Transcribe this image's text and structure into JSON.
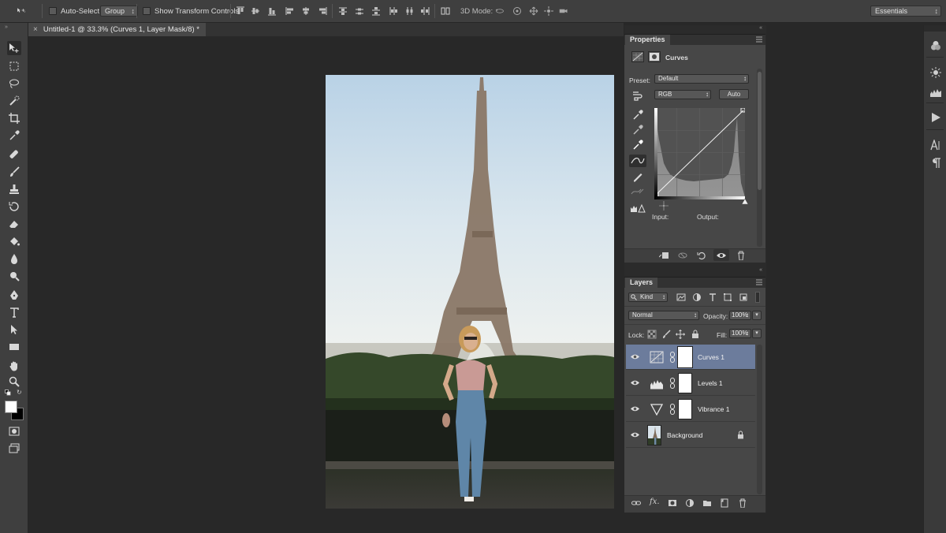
{
  "options_bar": {
    "auto_select_label": "Auto-Select:",
    "auto_select_value": "Group",
    "show_transform_label": "Show Transform Controls",
    "mode_3d_label": "3D Mode:",
    "workspace": "Essentials"
  },
  "document": {
    "tab_title": "Untitled-1 @ 33.3% (Curves 1, Layer Mask/8) *",
    "close_glyph": "×"
  },
  "properties": {
    "panel_title": "Properties",
    "adjustment_name": "Curves",
    "preset_label": "Preset:",
    "preset_value": "Default",
    "channel_value": "RGB",
    "auto_button": "Auto",
    "input_label": "Input:",
    "output_label": "Output:"
  },
  "layers": {
    "panel_title": "Layers",
    "filter_kind": "Kind",
    "blend_mode": "Normal",
    "opacity_label": "Opacity:",
    "opacity_value": "100%",
    "lock_label": "Lock:",
    "fill_label": "Fill:",
    "fill_value": "100%",
    "rows": [
      {
        "name": "Curves 1",
        "selected": true
      },
      {
        "name": "Levels 1",
        "selected": false
      },
      {
        "name": "Vibrance 1",
        "selected": false
      },
      {
        "name": "Background",
        "selected": false
      }
    ]
  },
  "colors": {
    "selection": "#6c7c9c",
    "panel_bg": "#474747",
    "chrome_bg": "#3f3f3f",
    "workspace_bg": "#282828"
  }
}
